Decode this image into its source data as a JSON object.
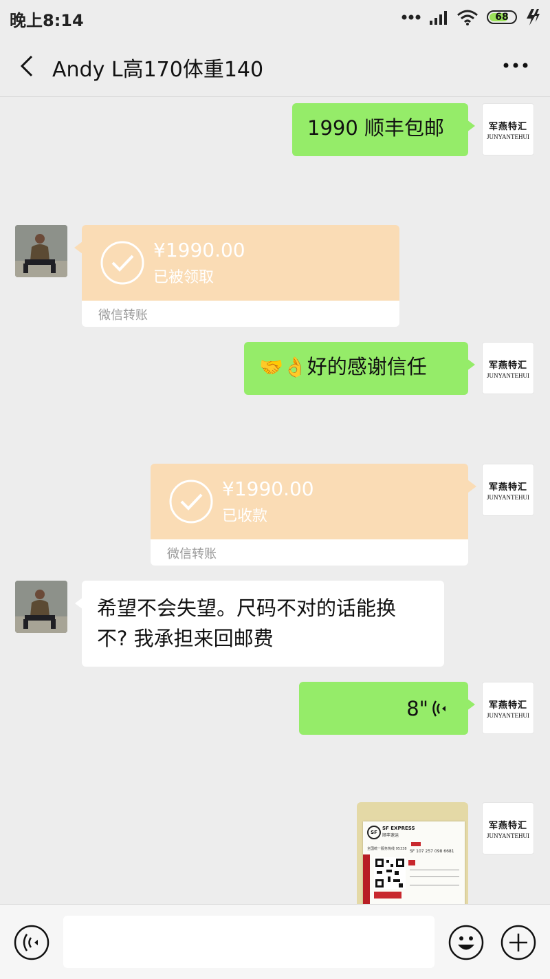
{
  "status": {
    "time": "晚上8:14",
    "battery": "68",
    "icons": [
      "dots-icon",
      "signal-icon",
      "wifi-icon",
      "battery-icon",
      "charging-icon"
    ]
  },
  "header": {
    "title": "Andy L高170体重140",
    "back_icon": "back-chevron-icon",
    "more_icon": "more-dots-icon"
  },
  "brand_avatar": {
    "cn": "军燕特汇",
    "en": "JUNYANTEHUI"
  },
  "messages": {
    "m1": {
      "text": "1990 顺丰包邮"
    },
    "m2": {
      "amount": "¥1990.00",
      "status": "已被领取",
      "label": "微信转账"
    },
    "m3": {
      "text": "好的感谢信任",
      "emojis": "🤝👌"
    },
    "m4": {
      "amount": "¥1990.00",
      "status": "已收款",
      "label": "微信转账"
    },
    "m5": {
      "line1": "希望不会失望。尺码不对的话能换",
      "line2": "不? 我承担来回邮费"
    },
    "m6": {
      "duration": "8\""
    },
    "m7": {
      "photo_brand": "SF EXPRESS",
      "photo_brand_cn": "顺丰速运",
      "photo_number": "SF 107 257 098 6681",
      "photo_hotline": "全国统一服务热线 95338"
    }
  },
  "colors": {
    "my_bubble": "#95ec69",
    "other_bubble": "#ffffff",
    "transfer_top": "#fadcb5",
    "background": "#ededed"
  }
}
